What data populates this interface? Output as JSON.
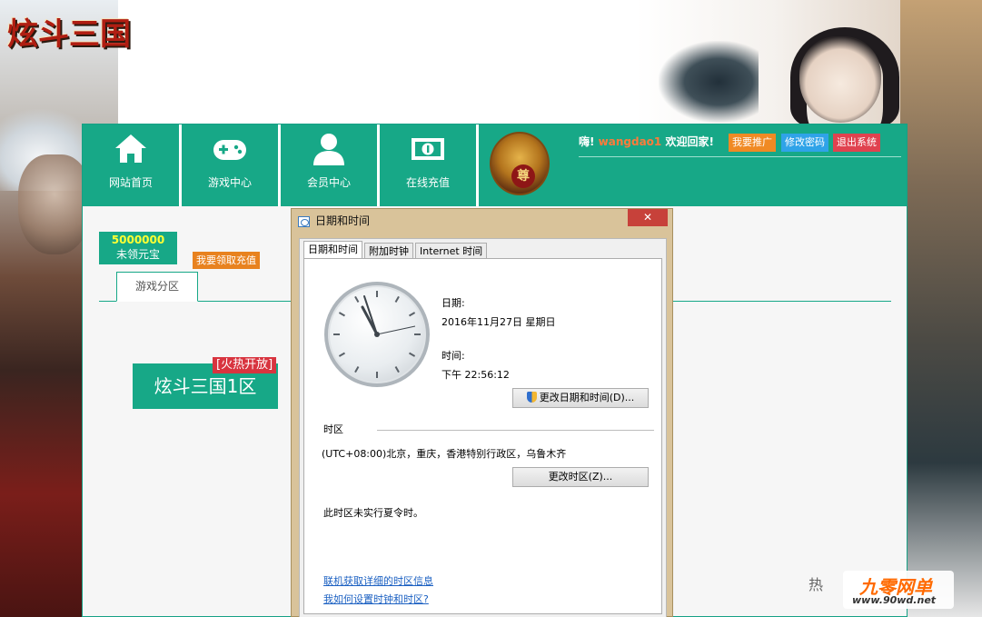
{
  "site": {
    "logo_text": "炫斗三国"
  },
  "nav": {
    "items": [
      {
        "label": "网站首页",
        "icon": "home-icon"
      },
      {
        "label": "游戏中心",
        "icon": "gamepad-icon"
      },
      {
        "label": "会员中心",
        "icon": "user-icon"
      },
      {
        "label": "在线充值",
        "icon": "money-icon"
      }
    ],
    "avatar_badge": "尊"
  },
  "header": {
    "greeting_prefix": "嗨!",
    "username": "wangdao1",
    "greeting_suffix": "欢迎回家!",
    "promote_label": "我要推广",
    "change_password_label": "修改密码",
    "logout_label": "退出系统"
  },
  "account": {
    "coin_value": "5000000",
    "coin_label": "未领元宝",
    "claim_label": "我要领取充值"
  },
  "zones": {
    "tab_label": "游戏分区",
    "server_label": "炫斗三国1区",
    "hot_tag": "[火热开放]"
  },
  "dialog": {
    "title": "日期和时间",
    "close_label": "✕",
    "tabs": [
      "日期和时间",
      "附加时钟",
      "Internet 时间"
    ],
    "date_label": "日期:",
    "date_value": "2016年11月27日 星期日",
    "time_label": "时间:",
    "time_value": "下午 22:56:12",
    "change_datetime_label": "更改日期和时间(D)...",
    "timezone_heading": "时区",
    "timezone_value": "(UTC+08:00)北京，重庆，香港特别行政区，乌鲁木齐",
    "change_timezone_label": "更改时区(Z)...",
    "dst_note": "此时区未实行夏令时。",
    "link_tz_info": "联机获取详细的时区信息",
    "link_how": "我如何设置时钟和时区?"
  },
  "watermark": {
    "side_text": "热",
    "brand": "九零网单",
    "url": "www.90wd.net"
  },
  "colors": {
    "primary_green": "#17a887",
    "orange": "#f08a24",
    "blue": "#2fa3e8",
    "red": "#e0424f",
    "link": "#1b60c2"
  }
}
